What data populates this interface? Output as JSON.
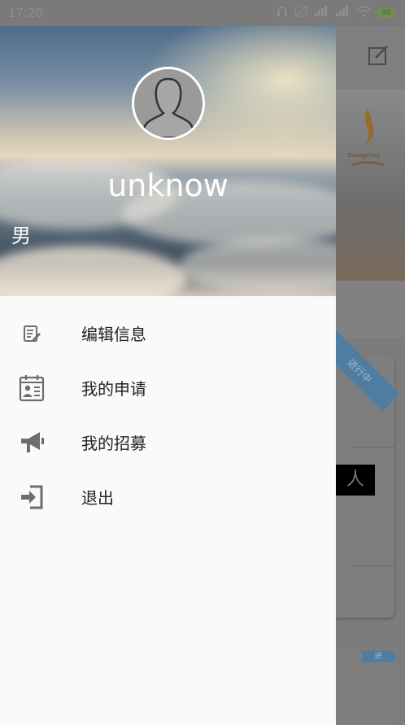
{
  "status_bar": {
    "time": "17:20",
    "icons": [
      "headphones-icon",
      "no-sim-icon",
      "signal-icon",
      "signal-icon-2",
      "wifi-icon"
    ],
    "battery": "98"
  },
  "background_app": {
    "ribbon_text": "进行中",
    "partial_text": "人",
    "ribbon2_text": "进"
  },
  "drawer": {
    "username": "unknow",
    "gender": "男",
    "menu": [
      {
        "label": "编辑信息",
        "icon": "edit-info-icon"
      },
      {
        "label": "我的申请",
        "icon": "application-card-icon"
      },
      {
        "label": "我的招募",
        "icon": "megaphone-icon"
      },
      {
        "label": "退出",
        "icon": "logout-icon"
      }
    ]
  },
  "colors": {
    "drawer_bg": "#fafafa",
    "overlay": "#7c7c7c",
    "ribbon": "#4f7da1",
    "text": "#222222",
    "icon": "#6d6d6d"
  }
}
